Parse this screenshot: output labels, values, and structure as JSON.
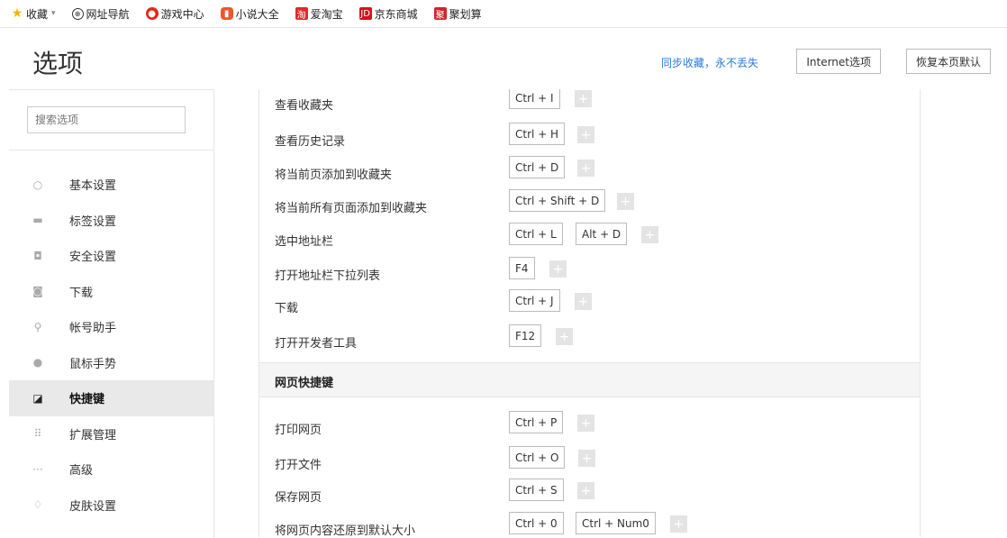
{
  "bookmarks": [
    {
      "label": "收藏",
      "icon": "star-icon"
    },
    {
      "label": "网址导航",
      "icon": "globe-icon"
    },
    {
      "label": "游戏中心",
      "icon": "game-icon"
    },
    {
      "label": "小说大全",
      "icon": "book-icon"
    },
    {
      "label": "爱淘宝",
      "icon": "taobao-icon"
    },
    {
      "label": "京东商城",
      "icon": "jd-icon"
    },
    {
      "label": "聚划算",
      "icon": "juhuasuan-icon"
    }
  ],
  "header": {
    "title": "选项",
    "sync_link": "同步收藏，永不丢失",
    "internet_options": "Internet选项",
    "reset_defaults": "恢复本页默认"
  },
  "sidebar": {
    "search_placeholder": "搜索选项",
    "items": [
      {
        "label": "基本设置",
        "icon": "settings-icon"
      },
      {
        "label": "标签设置",
        "icon": "tab-icon"
      },
      {
        "label": "安全设置",
        "icon": "shield-check-icon"
      },
      {
        "label": "下载",
        "icon": "download-icon"
      },
      {
        "label": "帐号助手",
        "icon": "key-icon"
      },
      {
        "label": "鼠标手势",
        "icon": "mouse-icon"
      },
      {
        "label": "快捷键",
        "icon": "shortcut-icon",
        "active": true
      },
      {
        "label": "扩展管理",
        "icon": "extension-icon"
      },
      {
        "label": "高级",
        "icon": "more-icon"
      },
      {
        "label": "皮肤设置",
        "icon": "skin-icon"
      }
    ]
  },
  "shortcuts_top": [
    {
      "label": "查看收藏夹",
      "keys": [
        "Ctrl + I"
      ]
    },
    {
      "label": "查看历史记录",
      "keys": [
        "Ctrl + H"
      ]
    },
    {
      "label": "将当前页添加到收藏夹",
      "keys": [
        "Ctrl + D"
      ]
    },
    {
      "label": "将当前所有页面添加到收藏夹",
      "keys": [
        "Ctrl + Shift + D"
      ]
    },
    {
      "label": "选中地址栏",
      "keys": [
        "Ctrl + L",
        "Alt + D"
      ]
    },
    {
      "label": "打开地址栏下拉列表",
      "keys": [
        "F4"
      ]
    },
    {
      "label": "下载",
      "keys": [
        "Ctrl + J"
      ]
    },
    {
      "label": "打开开发者工具",
      "keys": [
        "F12"
      ]
    }
  ],
  "section2_title": "网页快捷键",
  "shortcuts_web": [
    {
      "label": "打印网页",
      "keys": [
        "Ctrl + P"
      ]
    },
    {
      "label": "打开文件",
      "keys": [
        "Ctrl + O"
      ]
    },
    {
      "label": "保存网页",
      "keys": [
        "Ctrl + S"
      ]
    },
    {
      "label": "将网页内容还原到默认大小",
      "keys": [
        "Ctrl + 0",
        "Ctrl + Num0"
      ]
    }
  ],
  "add_symbol": "+",
  "colors": {
    "link": "#2a7ad5",
    "active_bg": "#e9e9e9"
  }
}
